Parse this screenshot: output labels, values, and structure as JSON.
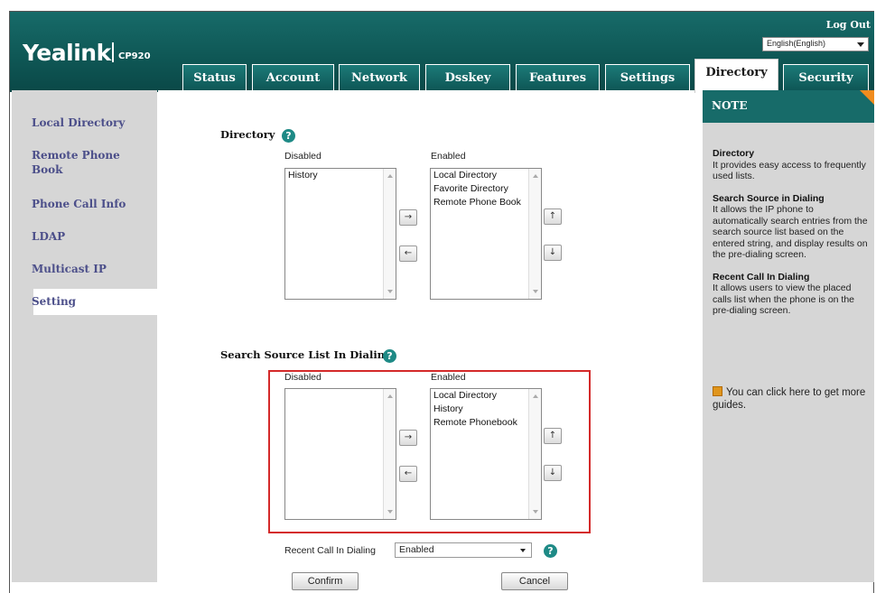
{
  "header": {
    "logo": "Yealink",
    "model": "CP920",
    "logout": "Log Out",
    "language": "English(English)"
  },
  "tabs": [
    {
      "label": "Status"
    },
    {
      "label": "Account"
    },
    {
      "label": "Network"
    },
    {
      "label": "Dsskey"
    },
    {
      "label": "Features"
    },
    {
      "label": "Settings"
    },
    {
      "label": "Directory"
    },
    {
      "label": "Security"
    }
  ],
  "active_tab": "Directory",
  "sidebar": {
    "items": [
      {
        "label": "Local Directory"
      },
      {
        "label": "Remote Phone Book"
      },
      {
        "label": "Phone Call Info"
      },
      {
        "label": "LDAP"
      },
      {
        "label": "Multicast IP"
      },
      {
        "label": "Setting"
      }
    ],
    "active": "Setting"
  },
  "directory": {
    "title": "Directory",
    "disabled_label": "Disabled",
    "enabled_label": "Enabled",
    "disabled_items": [
      "History"
    ],
    "enabled_items": [
      "Local Directory",
      "Favorite Directory",
      "Remote Phone Book"
    ]
  },
  "search_source": {
    "title": "Search Source List In Dialing",
    "disabled_label": "Disabled",
    "enabled_label": "Enabled",
    "disabled_items": [],
    "enabled_items": [
      "Local Directory",
      "History",
      "Remote Phonebook"
    ]
  },
  "recent_call": {
    "label": "Recent Call In Dialing",
    "value": "Enabled"
  },
  "buttons": {
    "move_right": "→",
    "move_left": "←",
    "move_up": "↑",
    "move_down": "↓",
    "confirm": "Confirm",
    "cancel": "Cancel"
  },
  "note": {
    "title": "NOTE",
    "sections": [
      {
        "title": "Directory",
        "text": "It provides easy access to frequently used lists."
      },
      {
        "title": "Search Source in Dialing",
        "text": "It allows the IP phone to automatically search entries from the search source list based on the entered string, and display results on the pre-dialing screen."
      },
      {
        "title": "Recent Call In Dialing",
        "text": "It allows users to view the placed calls list when the phone is on the pre-dialing screen."
      }
    ],
    "guide": "You can click here to get more guides."
  },
  "colors": {
    "header": "#0f5856",
    "nav_text": "#4c4f8a",
    "highlight_box": "#d42a2a",
    "note_corner": "#f08c1e"
  }
}
